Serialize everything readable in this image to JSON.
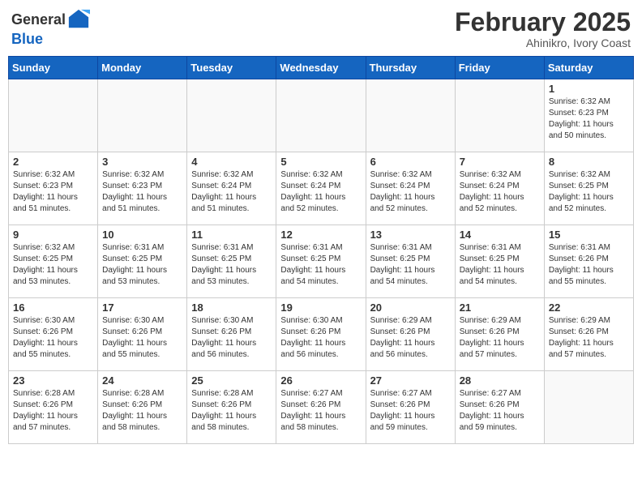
{
  "header": {
    "logo_general": "General",
    "logo_blue": "Blue",
    "month_year": "February 2025",
    "location": "Ahinikro, Ivory Coast"
  },
  "days_of_week": [
    "Sunday",
    "Monday",
    "Tuesday",
    "Wednesday",
    "Thursday",
    "Friday",
    "Saturday"
  ],
  "weeks": [
    [
      {
        "day": "",
        "info": ""
      },
      {
        "day": "",
        "info": ""
      },
      {
        "day": "",
        "info": ""
      },
      {
        "day": "",
        "info": ""
      },
      {
        "day": "",
        "info": ""
      },
      {
        "day": "",
        "info": ""
      },
      {
        "day": "1",
        "info": "Sunrise: 6:32 AM\nSunset: 6:23 PM\nDaylight: 11 hours\nand 50 minutes."
      }
    ],
    [
      {
        "day": "2",
        "info": "Sunrise: 6:32 AM\nSunset: 6:23 PM\nDaylight: 11 hours\nand 51 minutes."
      },
      {
        "day": "3",
        "info": "Sunrise: 6:32 AM\nSunset: 6:23 PM\nDaylight: 11 hours\nand 51 minutes."
      },
      {
        "day": "4",
        "info": "Sunrise: 6:32 AM\nSunset: 6:24 PM\nDaylight: 11 hours\nand 51 minutes."
      },
      {
        "day": "5",
        "info": "Sunrise: 6:32 AM\nSunset: 6:24 PM\nDaylight: 11 hours\nand 52 minutes."
      },
      {
        "day": "6",
        "info": "Sunrise: 6:32 AM\nSunset: 6:24 PM\nDaylight: 11 hours\nand 52 minutes."
      },
      {
        "day": "7",
        "info": "Sunrise: 6:32 AM\nSunset: 6:24 PM\nDaylight: 11 hours\nand 52 minutes."
      },
      {
        "day": "8",
        "info": "Sunrise: 6:32 AM\nSunset: 6:25 PM\nDaylight: 11 hours\nand 52 minutes."
      }
    ],
    [
      {
        "day": "9",
        "info": "Sunrise: 6:32 AM\nSunset: 6:25 PM\nDaylight: 11 hours\nand 53 minutes."
      },
      {
        "day": "10",
        "info": "Sunrise: 6:31 AM\nSunset: 6:25 PM\nDaylight: 11 hours\nand 53 minutes."
      },
      {
        "day": "11",
        "info": "Sunrise: 6:31 AM\nSunset: 6:25 PM\nDaylight: 11 hours\nand 53 minutes."
      },
      {
        "day": "12",
        "info": "Sunrise: 6:31 AM\nSunset: 6:25 PM\nDaylight: 11 hours\nand 54 minutes."
      },
      {
        "day": "13",
        "info": "Sunrise: 6:31 AM\nSunset: 6:25 PM\nDaylight: 11 hours\nand 54 minutes."
      },
      {
        "day": "14",
        "info": "Sunrise: 6:31 AM\nSunset: 6:25 PM\nDaylight: 11 hours\nand 54 minutes."
      },
      {
        "day": "15",
        "info": "Sunrise: 6:31 AM\nSunset: 6:26 PM\nDaylight: 11 hours\nand 55 minutes."
      }
    ],
    [
      {
        "day": "16",
        "info": "Sunrise: 6:30 AM\nSunset: 6:26 PM\nDaylight: 11 hours\nand 55 minutes."
      },
      {
        "day": "17",
        "info": "Sunrise: 6:30 AM\nSunset: 6:26 PM\nDaylight: 11 hours\nand 55 minutes."
      },
      {
        "day": "18",
        "info": "Sunrise: 6:30 AM\nSunset: 6:26 PM\nDaylight: 11 hours\nand 56 minutes."
      },
      {
        "day": "19",
        "info": "Sunrise: 6:30 AM\nSunset: 6:26 PM\nDaylight: 11 hours\nand 56 minutes."
      },
      {
        "day": "20",
        "info": "Sunrise: 6:29 AM\nSunset: 6:26 PM\nDaylight: 11 hours\nand 56 minutes."
      },
      {
        "day": "21",
        "info": "Sunrise: 6:29 AM\nSunset: 6:26 PM\nDaylight: 11 hours\nand 57 minutes."
      },
      {
        "day": "22",
        "info": "Sunrise: 6:29 AM\nSunset: 6:26 PM\nDaylight: 11 hours\nand 57 minutes."
      }
    ],
    [
      {
        "day": "23",
        "info": "Sunrise: 6:28 AM\nSunset: 6:26 PM\nDaylight: 11 hours\nand 57 minutes."
      },
      {
        "day": "24",
        "info": "Sunrise: 6:28 AM\nSunset: 6:26 PM\nDaylight: 11 hours\nand 58 minutes."
      },
      {
        "day": "25",
        "info": "Sunrise: 6:28 AM\nSunset: 6:26 PM\nDaylight: 11 hours\nand 58 minutes."
      },
      {
        "day": "26",
        "info": "Sunrise: 6:27 AM\nSunset: 6:26 PM\nDaylight: 11 hours\nand 58 minutes."
      },
      {
        "day": "27",
        "info": "Sunrise: 6:27 AM\nSunset: 6:26 PM\nDaylight: 11 hours\nand 59 minutes."
      },
      {
        "day": "28",
        "info": "Sunrise: 6:27 AM\nSunset: 6:26 PM\nDaylight: 11 hours\nand 59 minutes."
      },
      {
        "day": "",
        "info": ""
      }
    ]
  ]
}
